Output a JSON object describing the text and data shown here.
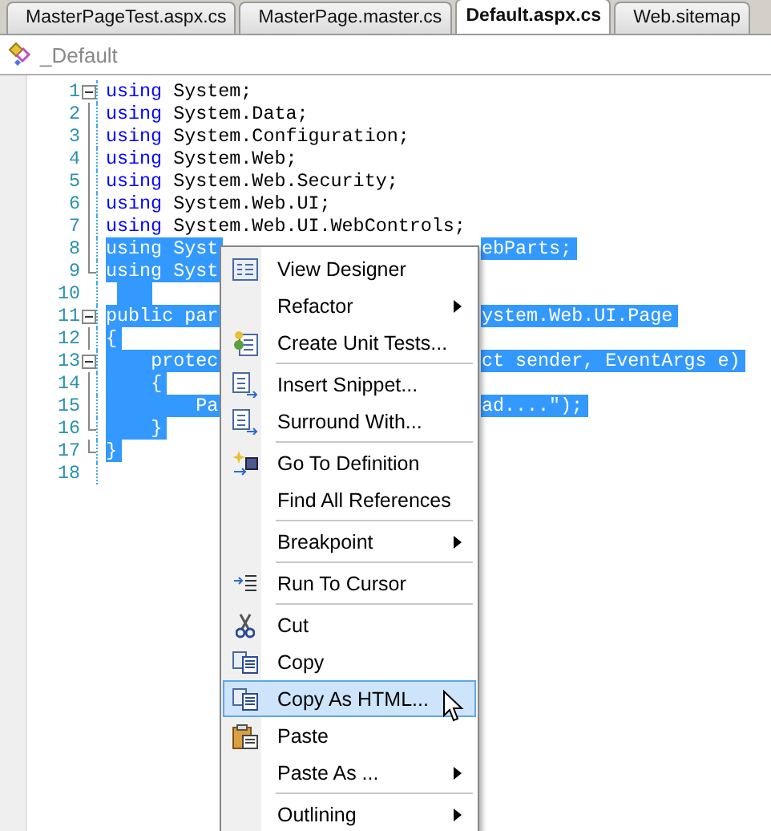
{
  "tabs": [
    {
      "label": "MasterPageTest.aspx.cs",
      "selected": false
    },
    {
      "label": "MasterPage.master.cs",
      "selected": false
    },
    {
      "label": "Default.aspx.cs",
      "selected": true
    },
    {
      "label": "Web.sitemap",
      "selected": false
    }
  ],
  "class_bar": {
    "label": "_Default"
  },
  "code_lines": [
    {
      "number": "1",
      "kind": "start",
      "left": "using System;",
      "selected": false
    },
    {
      "number": "2",
      "kind": "inner",
      "left": "using System.Data;",
      "selected": false
    },
    {
      "number": "3",
      "kind": "inner",
      "left": "using System.Configuration;",
      "selected": false
    },
    {
      "number": "4",
      "kind": "inner",
      "left": "using System.Web;",
      "selected": false
    },
    {
      "number": "5",
      "kind": "inner",
      "left": "using System.Web.Security;",
      "selected": false
    },
    {
      "number": "6",
      "kind": "inner",
      "left": "using System.Web.UI;",
      "selected": false
    },
    {
      "number": "7",
      "kind": "inner",
      "left": "using System.Web.UI.WebControls;",
      "selected": false
    },
    {
      "number": "8",
      "kind": "inner",
      "left": "using Syst",
      "right": "ebParts;",
      "selected": true
    },
    {
      "number": "9",
      "kind": "end",
      "left": "using Syst",
      "selected": true
    },
    {
      "number": "10",
      "kind": "plain",
      "selected": true
    },
    {
      "number": "11",
      "kind": "start",
      "left": "public par",
      "right": "ystem.Web.UI.Page",
      "selected": true
    },
    {
      "number": "12",
      "kind": "inner",
      "left": "{",
      "selected": true
    },
    {
      "number": "13",
      "kind": "start",
      "left": "    protec",
      "right": "ct sender, EventArgs e)",
      "selected": true
    },
    {
      "number": "14",
      "kind": "inner",
      "left": "    {",
      "selected": true
    },
    {
      "number": "15",
      "kind": "inner",
      "left": "        Pa",
      "right": "ad....\");",
      "selected": true
    },
    {
      "number": "16",
      "kind": "end",
      "left": "    }",
      "selected": true
    },
    {
      "number": "17",
      "kind": "end",
      "left": "}",
      "selected": true
    },
    {
      "number": "18",
      "kind": "plain",
      "selected": false
    }
  ],
  "context_menu": [
    {
      "label": "View Designer",
      "submenu": false,
      "separator_after": false,
      "selected": false
    },
    {
      "label": "Refactor",
      "submenu": true,
      "separator_after": false,
      "selected": false
    },
    {
      "label": "Create Unit Tests...",
      "submenu": false,
      "separator_after": true,
      "selected": false
    },
    {
      "label": "Insert Snippet...",
      "submenu": false,
      "separator_after": false,
      "selected": false
    },
    {
      "label": "Surround With...",
      "submenu": false,
      "separator_after": true,
      "selected": false
    },
    {
      "label": "Go To Definition",
      "submenu": false,
      "separator_after": false,
      "selected": false
    },
    {
      "label": "Find All References",
      "submenu": false,
      "separator_after": true,
      "selected": false
    },
    {
      "label": "Breakpoint",
      "submenu": true,
      "separator_after": true,
      "selected": false
    },
    {
      "label": "Run To Cursor",
      "submenu": false,
      "separator_after": true,
      "selected": false
    },
    {
      "label": "Cut",
      "submenu": false,
      "separator_after": false,
      "selected": false
    },
    {
      "label": "Copy",
      "submenu": false,
      "separator_after": false,
      "selected": false
    },
    {
      "label": "Copy As HTML...",
      "submenu": false,
      "separator_after": false,
      "selected": true
    },
    {
      "label": "Paste",
      "submenu": false,
      "separator_after": false,
      "selected": false
    },
    {
      "label": "Paste As ...",
      "submenu": true,
      "separator_after": true,
      "selected": false
    },
    {
      "label": "Outlining",
      "submenu": true,
      "separator_after": false,
      "selected": false
    }
  ]
}
